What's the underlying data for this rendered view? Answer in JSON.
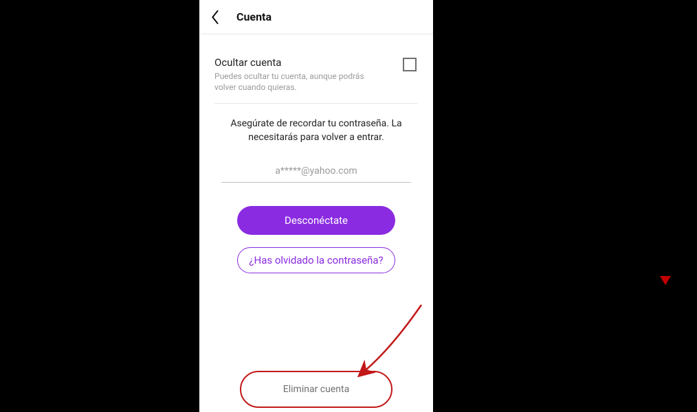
{
  "header": {
    "title": "Cuenta"
  },
  "hide": {
    "title": "Ocultar cuenta",
    "subtitle": "Puedes ocultar tu cuenta, aunque podrás volver cuando quieras."
  },
  "info": "Asegúrate de recordar tu contraseña. La necesitarás para volver a entrar.",
  "email": "a*****@yahoo.com",
  "buttons": {
    "disconnect": "Desconéctate",
    "forgot": "¿Has olvidado la contraseña?",
    "delete": "Eliminar cuenta"
  },
  "colors": {
    "accent": "#8a2be2",
    "annotation": "#c21818"
  }
}
